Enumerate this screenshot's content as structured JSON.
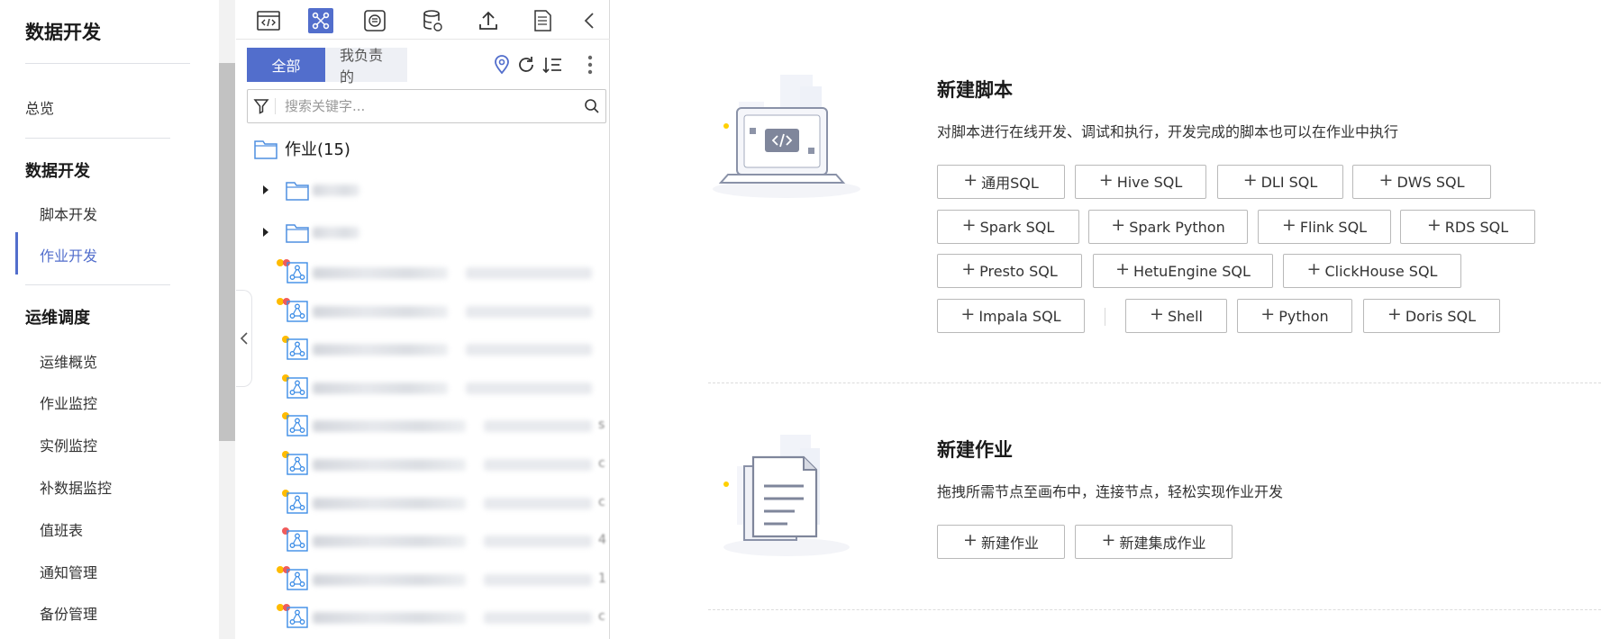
{
  "nav": {
    "title": "数据开发",
    "overview": "总览",
    "group_dev": "数据开发",
    "script_dev": "脚本开发",
    "job_dev": "作业开发",
    "group_ops": "运维调度",
    "ops_items": [
      "运维概览",
      "作业监控",
      "实例监控",
      "补数据监控",
      "值班表",
      "通知管理",
      "备份管理"
    ]
  },
  "toolbar": {
    "icons": [
      "script-icon",
      "job-icon",
      "resource-icon",
      "database-icon",
      "upload-icon",
      "document-icon",
      "collapse-left-icon"
    ],
    "active_index": 1
  },
  "filter": {
    "all": "全部",
    "mine": "我负责的"
  },
  "search": {
    "placeholder": "搜索关键字..."
  },
  "tree": {
    "root_label": "作业(15)",
    "folders": 2,
    "job_status": [
      [
        "y",
        "r"
      ],
      [
        "y",
        "r"
      ],
      [
        "y"
      ],
      [
        "y"
      ],
      [
        "y"
      ],
      [
        "y"
      ],
      [
        "y"
      ],
      [
        "r"
      ],
      [
        "y",
        "r"
      ],
      [
        "y",
        "r"
      ]
    ]
  },
  "script_section": {
    "title": "新建脚本",
    "desc": "对脚本进行在线开发、调试和执行，开发完成的脚本也可以在作业中执行",
    "buttons": [
      "通用SQL",
      "Hive SQL",
      "DLI SQL",
      "DWS SQL",
      "Spark SQL",
      "Spark Python",
      "Flink SQL",
      "RDS SQL",
      "Presto SQL",
      "HetuEngine SQL",
      "ClickHouse SQL",
      "Impala SQL",
      "Shell",
      "Python",
      "Doris SQL"
    ]
  },
  "job_section": {
    "title": "新建作业",
    "desc": "拖拽所需节点至画布中，连接节点，轻松实现作业开发",
    "buttons": [
      "新建作业",
      "新建集成作业"
    ]
  },
  "colors": {
    "accent": "#526ecc",
    "dot_yellow": "#ffbb00",
    "dot_red": "#f05b5b"
  }
}
